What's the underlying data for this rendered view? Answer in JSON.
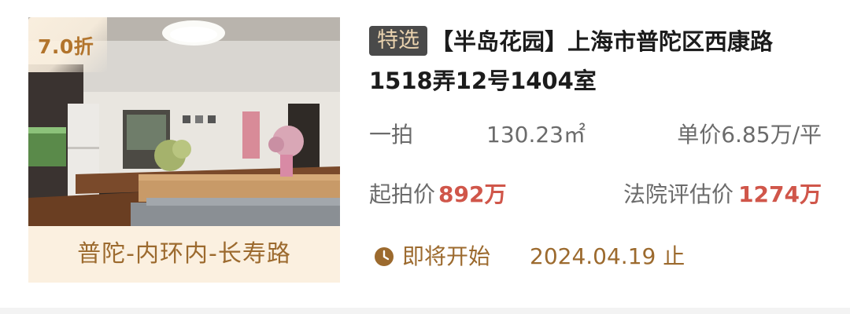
{
  "listing": {
    "discount": "7.0折",
    "location": "普陀-内环内-长寿路",
    "badge": "特选",
    "title": "【半岛花园】上海市普陀区西康路1518弄12号1404室",
    "auction_type": "一拍",
    "area": "130.23㎡",
    "unit_price": "单价6.85万/平",
    "start_price_label": "起拍价",
    "start_price_value": "892万",
    "court_price_label": "法院评估价",
    "court_price_value": "1274万",
    "status": "即将开始",
    "end_date": "2024.04.19 止"
  },
  "colors": {
    "accent_gold": "#9c6a2e",
    "price_red": "#d0564a",
    "badge_bg": "#4a4a4a",
    "badge_text": "#e9d2ae",
    "location_bg": "#fbf0e0"
  },
  "icons": {
    "status_icon": "clock-icon"
  }
}
